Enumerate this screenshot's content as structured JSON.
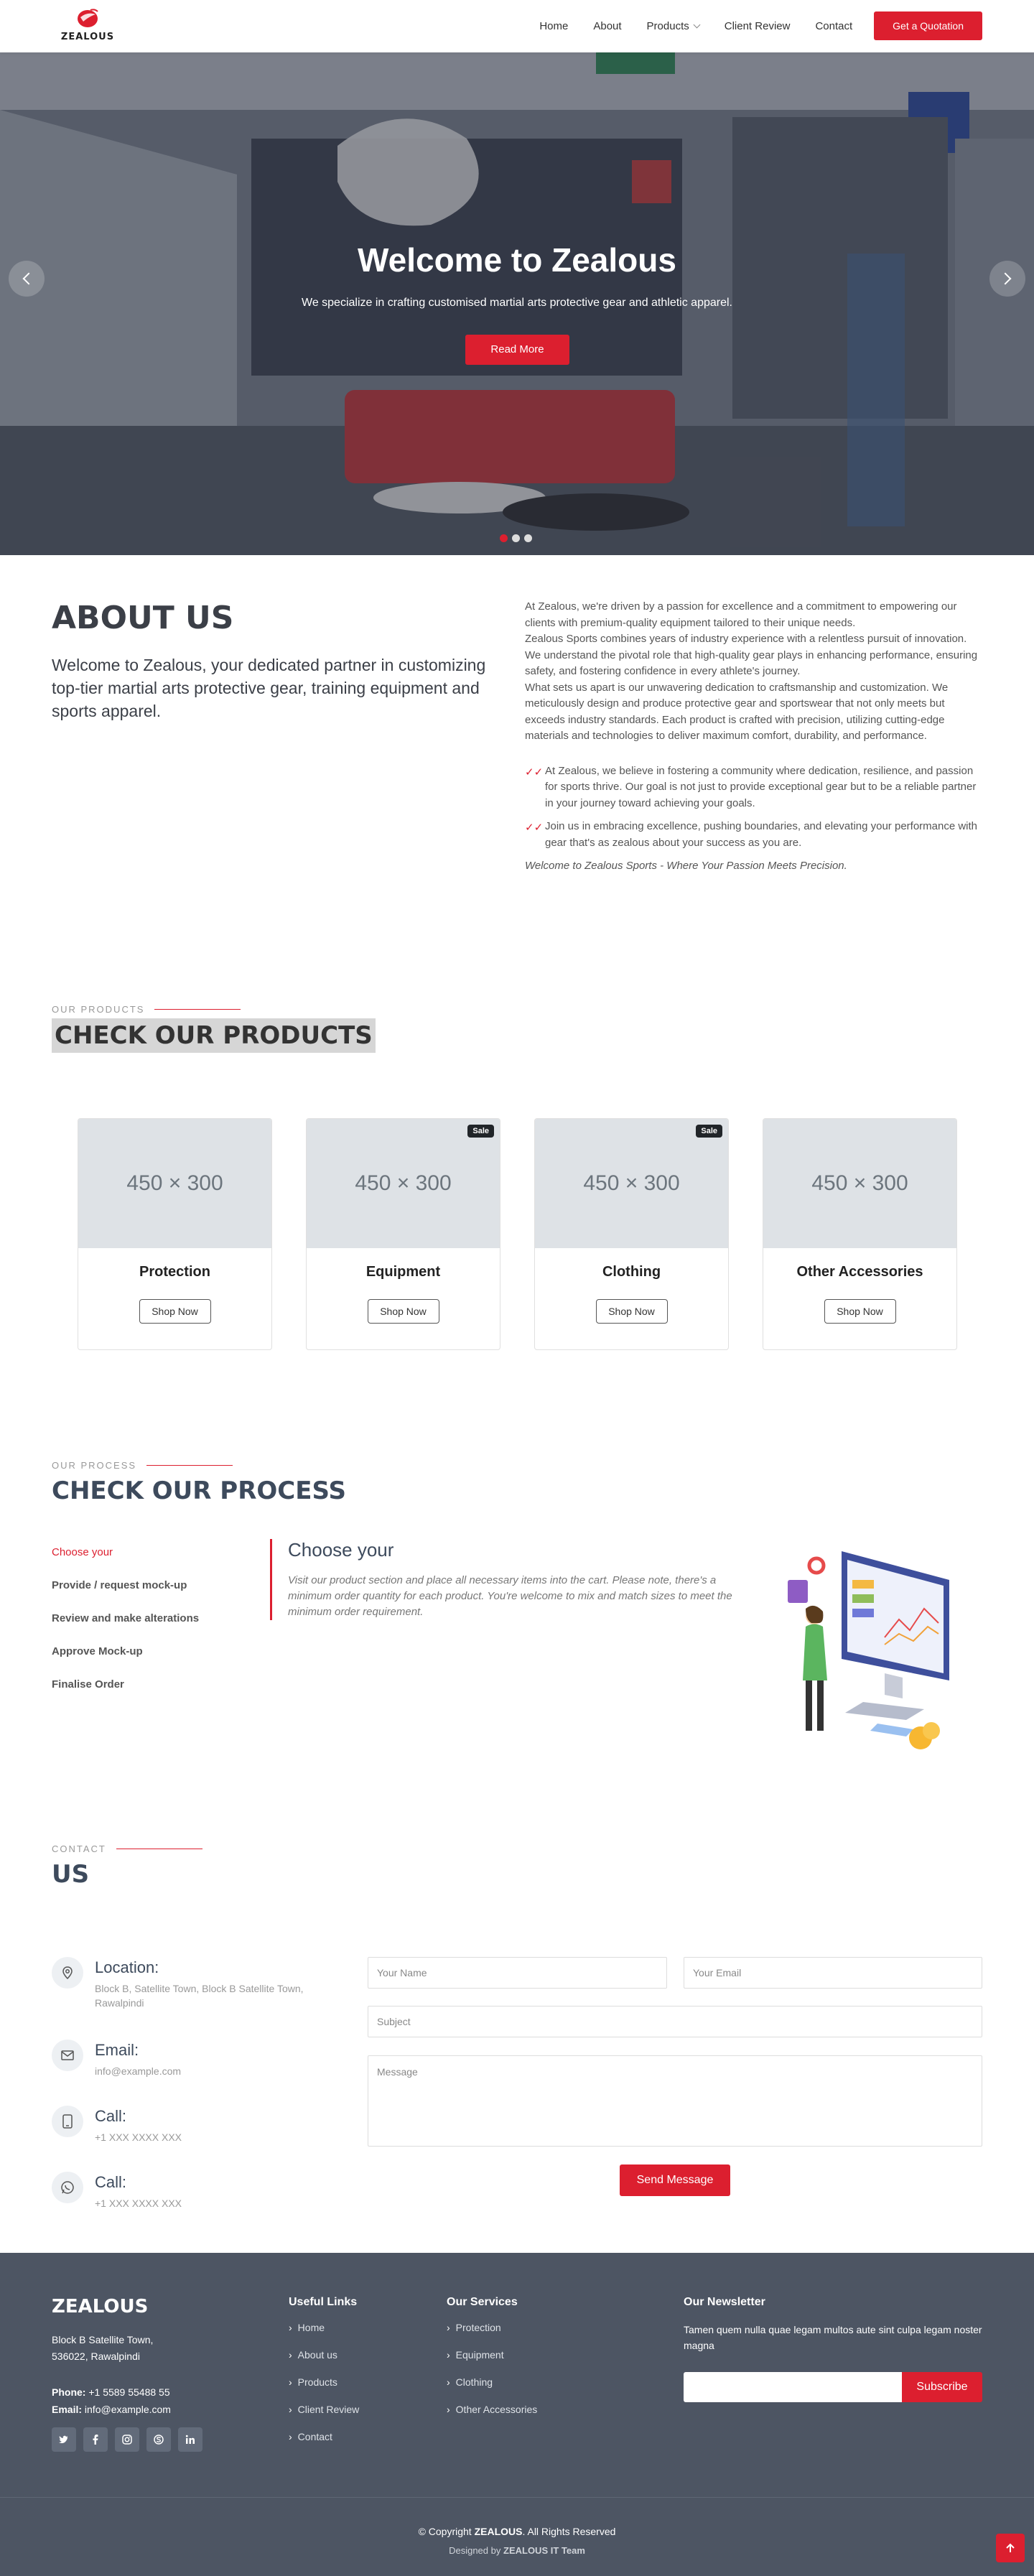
{
  "header": {
    "logo_text": "ZEALOUS",
    "nav": [
      "Home",
      "About",
      "Products",
      "Client Review",
      "Contact"
    ],
    "cta": "Get a Quotation"
  },
  "hero": {
    "title": "Welcome to Zealous",
    "subtitle": "We specialize in crafting customised martial arts protective gear and athletic apparel.",
    "button": "Read More",
    "slides": 3,
    "active_slide": 1
  },
  "about": {
    "title": "ABOUT US",
    "lead": "Welcome to Zealous, your dedicated partner in customizing top-tier martial arts protective gear, training equipment and sports apparel.",
    "p1": "At Zealous, we're driven by a passion for excellence and a commitment to empowering our clients with premium-quality equipment tailored to their unique needs.",
    "p2": "Zealous Sports combines years of industry experience with a relentless pursuit of innovation. We understand the pivotal role that high-quality gear plays in enhancing performance, ensuring safety, and fostering confidence in every athlete's journey.",
    "p3": "What sets us apart is our unwavering dedication to craftsmanship and customization. We meticulously design and produce protective gear and sportswear that not only meets but exceeds industry standards. Each product is crafted with precision, utilizing cutting-edge materials and technologies to deliver maximum comfort, durability, and performance.",
    "bullets": [
      "At Zealous, we believe in fostering a community where dedication, resilience, and passion for sports thrive. Our goal is not just to provide exceptional gear but to be a reliable partner in your journey toward achieving your goals.",
      "Join us in embracing excellence, pushing boundaries, and elevating your performance with gear that's as zealous about your success as you are."
    ],
    "tagline": "Welcome to Zealous Sports - Where Your Passion Meets Precision."
  },
  "products": {
    "eyebrow": "OUR PRODUCTS",
    "title": "CHECK OUR PRODUCTS",
    "placeholder": "450 × 300",
    "shop_label": "Shop Now",
    "sale_label": "Sale",
    "items": [
      {
        "name": "Protection",
        "sale": false
      },
      {
        "name": "Equipment",
        "sale": true
      },
      {
        "name": "Clothing",
        "sale": true
      },
      {
        "name": "Other Accessories",
        "sale": false
      }
    ]
  },
  "process": {
    "eyebrow": "OUR PROCESS",
    "title": "CHECK OUR PROCESS",
    "steps": [
      "Choose your",
      "Provide / request mock-up",
      "Review and make alterations",
      "Approve Mock-up",
      "Finalise Order"
    ],
    "panel_title": "Choose your",
    "panel_text": "Visit our product section and place all necessary items into the cart. Please note, there's a minimum order quantity for each product. You're welcome to mix and match sizes to meet the minimum order requirement."
  },
  "contact": {
    "eyebrow": "CONTACT",
    "title": "US",
    "location_label": "Location:",
    "location_value": "Block B, Satellite Town, Block B Satellite Town, Rawalpindi",
    "email_label": "Email:",
    "email_value": "info@example.com",
    "call_label": "Call:",
    "call_value": "+1 XXX XXXX XXX",
    "call2_label": "Call:",
    "call2_value": "+1 XXX XXXX XXX",
    "form": {
      "name": "Your Name",
      "email": "Your Email",
      "subject": "Subject",
      "message": "Message",
      "send": "Send Message"
    }
  },
  "footer": {
    "brand": "ZEALOUS",
    "address1": "Block B Satellite Town,",
    "address2": "536022, Rawalpindi",
    "phone_label": "Phone:",
    "phone": "+1 5589 55488 55",
    "email_label": "Email:",
    "email": "info@example.com",
    "useful_title": "Useful Links",
    "useful": [
      "Home",
      "About us",
      "Products",
      "Client Review",
      "Contact"
    ],
    "services_title": "Our Services",
    "services": [
      "Protection",
      "Equipment",
      "Clothing",
      "Other Accessories"
    ],
    "news_title": "Our Newsletter",
    "news_text": "Tamen quem nulla quae legam multos aute sint culpa legam noster magna",
    "subscribe": "Subscribe",
    "copyright_pre": "© Copyright",
    "copyright_brand": "ZEALOUS",
    "copyright_post": ". All Rights Reserved",
    "designed_pre": "Designed by",
    "designed_by": "ZEALOUS IT Team"
  },
  "colors": {
    "accent": "#dc1f2f",
    "footer": "#4d5563",
    "heading": "#3d4a5c"
  }
}
